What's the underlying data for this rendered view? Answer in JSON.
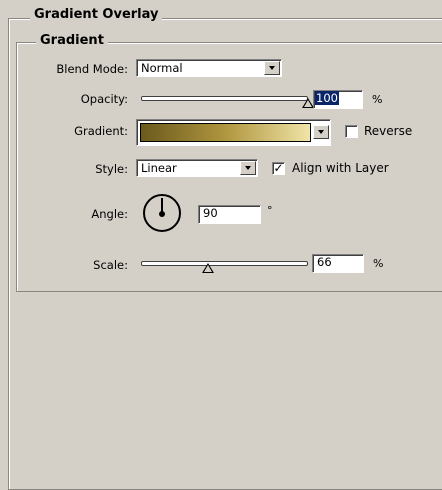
{
  "panel": {
    "title": "Gradient Overlay",
    "section_title": "Gradient"
  },
  "blend_mode": {
    "label": "Blend Mode:",
    "value": "Normal"
  },
  "opacity": {
    "label": "Opacity:",
    "value": "100",
    "unit": "%",
    "level": 1.0
  },
  "gradient": {
    "label": "Gradient:",
    "stops": [
      "#6b5a1e",
      "#b0963f",
      "#f0e4a8"
    ],
    "reverse_label": "Reverse",
    "reverse_checked": false
  },
  "style": {
    "label": "Style:",
    "value": "Linear",
    "align_label": "Align with Layer",
    "align_checked": true,
    "check_mark": "✓"
  },
  "angle": {
    "label": "Angle:",
    "value": "90",
    "unit": "°"
  },
  "scale": {
    "label": "Scale:",
    "value": "66",
    "unit": "%",
    "level": 0.4
  },
  "colors": {
    "selection_bg": "#0a246a",
    "selection_fg": "#ffffff"
  }
}
